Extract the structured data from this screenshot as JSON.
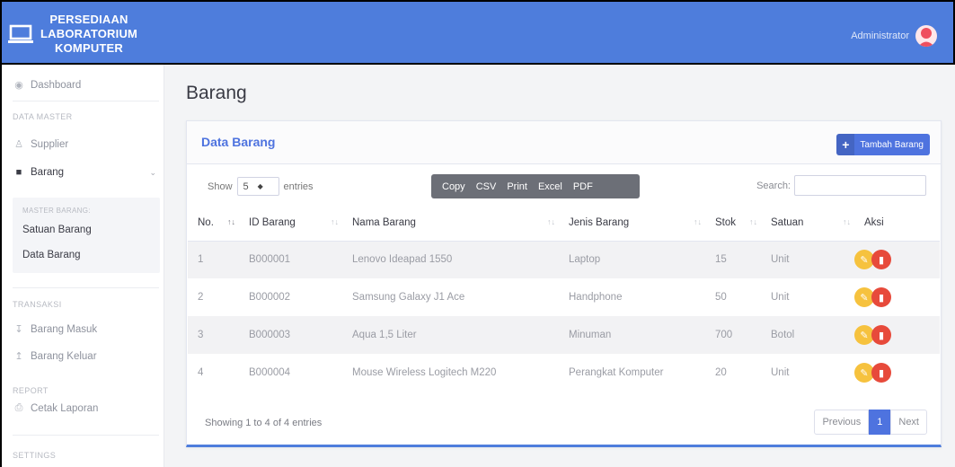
{
  "app": {
    "brand_lines": [
      "PERSEDIAAN",
      "LABORATORIUM",
      "KOMPUTER"
    ],
    "user_name": "Administrator"
  },
  "sidebar": {
    "dashboard": "Dashboard",
    "data_master_heading": "DATA MASTER",
    "supplier": "Supplier",
    "barang": "Barang",
    "master_barang_heading": "MASTER BARANG:",
    "satuan_barang": "Satuan Barang",
    "data_barang": "Data Barang",
    "transaksi_heading": "TRANSAKSI",
    "barang_masuk": "Barang Masuk",
    "barang_keluar": "Barang Keluar",
    "report_heading": "REPORT",
    "cetak_laporan": "Cetak Laporan",
    "settings_heading": "SETTINGS"
  },
  "main": {
    "page_title": "Barang",
    "card_title": "Data Barang",
    "add_button": "Tambah Barang",
    "show_label": "Show",
    "entries_value": "5",
    "entries_label": "entries",
    "export_buttons": [
      "Copy",
      "CSV",
      "Print",
      "Excel",
      "PDF"
    ],
    "search_label": "Search:",
    "table": {
      "headers": [
        "No.",
        "ID Barang",
        "Nama Barang",
        "Jenis Barang",
        "Stok",
        "Satuan",
        "Aksi"
      ],
      "rows": [
        [
          "1",
          "B000001",
          "Lenovo Ideapad 1550",
          "Laptop",
          "15",
          "Unit"
        ],
        [
          "2",
          "B000002",
          "Samsung Galaxy J1 Ace",
          "Handphone",
          "50",
          "Unit"
        ],
        [
          "3",
          "B000003",
          "Aqua 1,5 Liter",
          "Minuman",
          "700",
          "Botol"
        ],
        [
          "4",
          "B000004",
          "Mouse Wireless Logitech M220",
          "Perangkat Komputer",
          "20",
          "Unit"
        ]
      ]
    },
    "info_text": "Showing 1 to 4 of 4 entries",
    "pagination": {
      "previous": "Previous",
      "current": "1",
      "next": "Next"
    }
  },
  "colors": {
    "primary": "#4e73df",
    "topbar": "#4e7ddc",
    "edit": "#f6c23e",
    "delete": "#e74a3b"
  }
}
